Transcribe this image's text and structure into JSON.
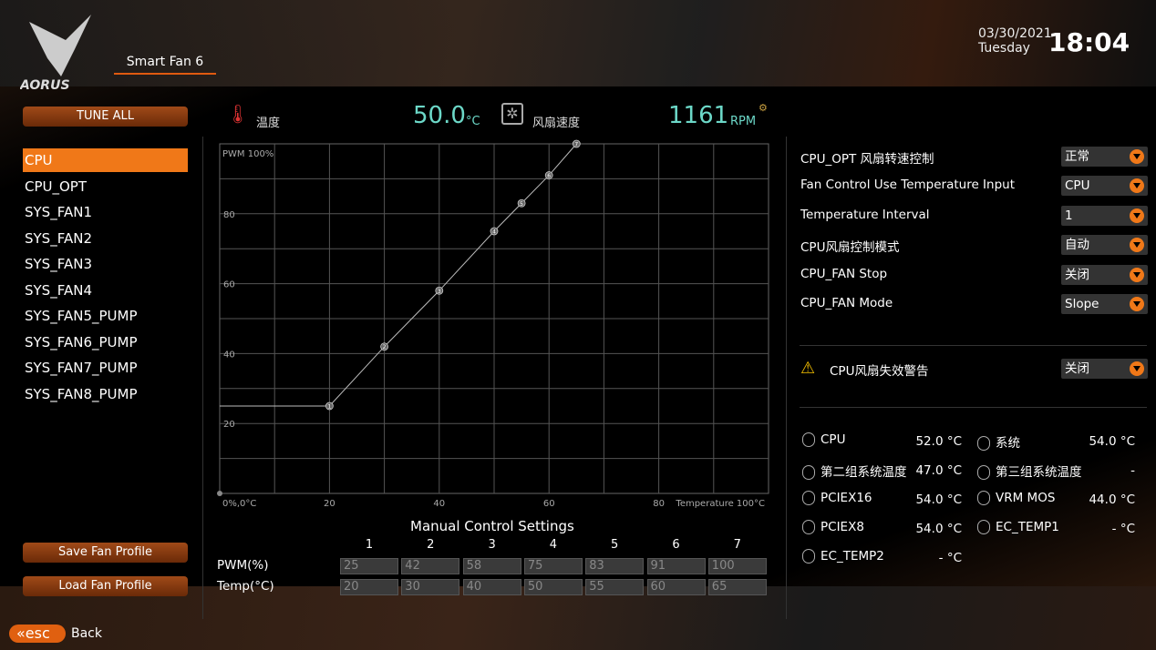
{
  "header": {
    "logo_text": "AORUS",
    "tab": "Smart Fan 6",
    "date": "03/30/2021",
    "weekday": "Tuesday",
    "time": "18:04"
  },
  "sidebar": {
    "tune_all": "TUNE ALL",
    "fans": [
      "CPU",
      "CPU_OPT",
      "SYS_FAN1",
      "SYS_FAN2",
      "SYS_FAN3",
      "SYS_FAN4",
      "SYS_FAN5_PUMP",
      "SYS_FAN6_PUMP",
      "SYS_FAN7_PUMP",
      "SYS_FAN8_PUMP"
    ],
    "selected": "CPU",
    "save": "Save Fan Profile",
    "load": "Load Fan Profile"
  },
  "readout": {
    "temp_label": "温度",
    "temp_value": "50.0",
    "temp_unit": "°C",
    "fan_label": "风扇速度",
    "fan_value": "1161",
    "fan_unit": "RPM"
  },
  "chart_data": {
    "type": "line",
    "ylabel": "PWM 100%",
    "xlabel": "Temperature 100°C",
    "origin_label": "0%,0°C",
    "x_ticks": [
      "20",
      "40",
      "60",
      "80"
    ],
    "y_ticks": [
      "20",
      "40",
      "60",
      "80"
    ],
    "xlim": [
      0,
      100
    ],
    "ylim": [
      0,
      100
    ],
    "grid": true,
    "points": [
      {
        "n": "1",
        "x": 20,
        "y": 25
      },
      {
        "n": "2",
        "x": 30,
        "y": 42
      },
      {
        "n": "3",
        "x": 40,
        "y": 58
      },
      {
        "n": "4",
        "x": 50,
        "y": 75
      },
      {
        "n": "5",
        "x": 55,
        "y": 83
      },
      {
        "n": "6",
        "x": 60,
        "y": 91
      },
      {
        "n": "7",
        "x": 65,
        "y": 100
      }
    ]
  },
  "manual": {
    "title": "Manual Control Settings",
    "cols": [
      "1",
      "2",
      "3",
      "4",
      "5",
      "6",
      "7"
    ],
    "pwm_label": "PWM(%)",
    "temp_label": "Temp(°C)",
    "pwm": [
      "25",
      "42",
      "58",
      "75",
      "83",
      "91",
      "100"
    ],
    "temp": [
      "20",
      "30",
      "40",
      "50",
      "55",
      "60",
      "65"
    ]
  },
  "settings": [
    {
      "label": "CPU_OPT 风扇转速控制",
      "value": "正常"
    },
    {
      "label": "Fan Control Use Temperature Input",
      "value": "CPU"
    },
    {
      "label": "Temperature Interval",
      "value": "1"
    },
    {
      "label": "CPU风扇控制模式",
      "value": "自动"
    },
    {
      "label": "CPU_FAN Stop",
      "value": "关闭"
    },
    {
      "label": "CPU_FAN Mode",
      "value": "Slope"
    }
  ],
  "warning": {
    "label": "CPU风扇失效警告",
    "value": "关闭"
  },
  "monitor": [
    {
      "label": "CPU",
      "value": "52.0 °C"
    },
    {
      "label": "系统",
      "value": "54.0 °C"
    },
    {
      "label": "第二组系统温度",
      "value": "47.0 °C"
    },
    {
      "label": "第三组系统温度",
      "value": "-"
    },
    {
      "label": "PCIEX16",
      "value": "54.0 °C"
    },
    {
      "label": "VRM MOS",
      "value": "44.0 °C"
    },
    {
      "label": "PCIEX8",
      "value": "54.0 °C"
    },
    {
      "label": "EC_TEMP1",
      "value": "- °C"
    },
    {
      "label": "EC_TEMP2",
      "value": "- °C"
    }
  ],
  "footer": {
    "esc": "esc",
    "back": "Back"
  },
  "colors": {
    "accent": "#f07818",
    "value": "#6cd8c8"
  }
}
